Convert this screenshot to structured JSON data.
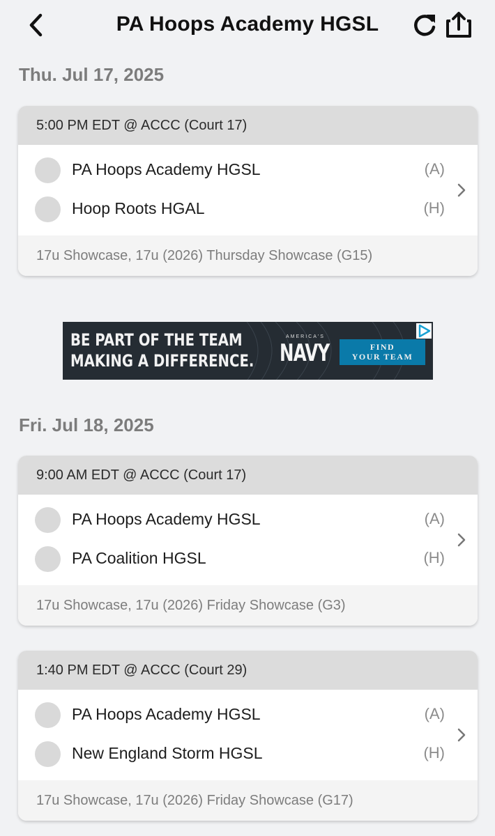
{
  "header": {
    "title": "PA Hoops Academy HGSL",
    "back_icon": "chevron-left-icon",
    "refresh_icon": "refresh-icon",
    "share_icon": "share-icon"
  },
  "sections": [
    {
      "date": "Thu. Jul 17, 2025",
      "games": [
        {
          "time_location": "5:00 PM EDT @ ACCC (Court 17)",
          "teams": [
            {
              "name": "PA Hoops Academy HGSL",
              "side": "(A)"
            },
            {
              "name": "Hoop Roots HGAL",
              "side": "(H)"
            }
          ],
          "division": "17u Showcase, 17u (2026) Thursday Showcase (G15)"
        }
      ]
    },
    {
      "date": "Fri. Jul 18, 2025",
      "games": [
        {
          "time_location": "9:00 AM EDT @ ACCC (Court 17)",
          "teams": [
            {
              "name": "PA Hoops Academy HGSL",
              "side": "(A)"
            },
            {
              "name": "PA Coalition HGSL",
              "side": "(H)"
            }
          ],
          "division": "17u Showcase, 17u (2026) Friday Showcase (G3)"
        },
        {
          "time_location": "1:40 PM EDT @ ACCC (Court 29)",
          "teams": [
            {
              "name": "PA Hoops Academy HGSL",
              "side": "(A)"
            },
            {
              "name": "New England Storm HGSL",
              "side": "(H)"
            }
          ],
          "division": "17u Showcase, 17u (2026) Friday Showcase (G17)"
        }
      ]
    }
  ],
  "ad": {
    "line1": "BE PART OF THE TEAM",
    "line2": "MAKING A DIFFERENCE.",
    "brand_top": "AMERICA'S",
    "brand": "NAVY",
    "cta_line1": "FIND",
    "cta_line2": "YOUR TEAM",
    "adchoices_icon": "adchoices-icon"
  },
  "colors": {
    "background": "#f1f2f4",
    "card_header": "#dcdcdc",
    "ad_background": "#252c33",
    "ad_cta": "#0a7aa9"
  }
}
